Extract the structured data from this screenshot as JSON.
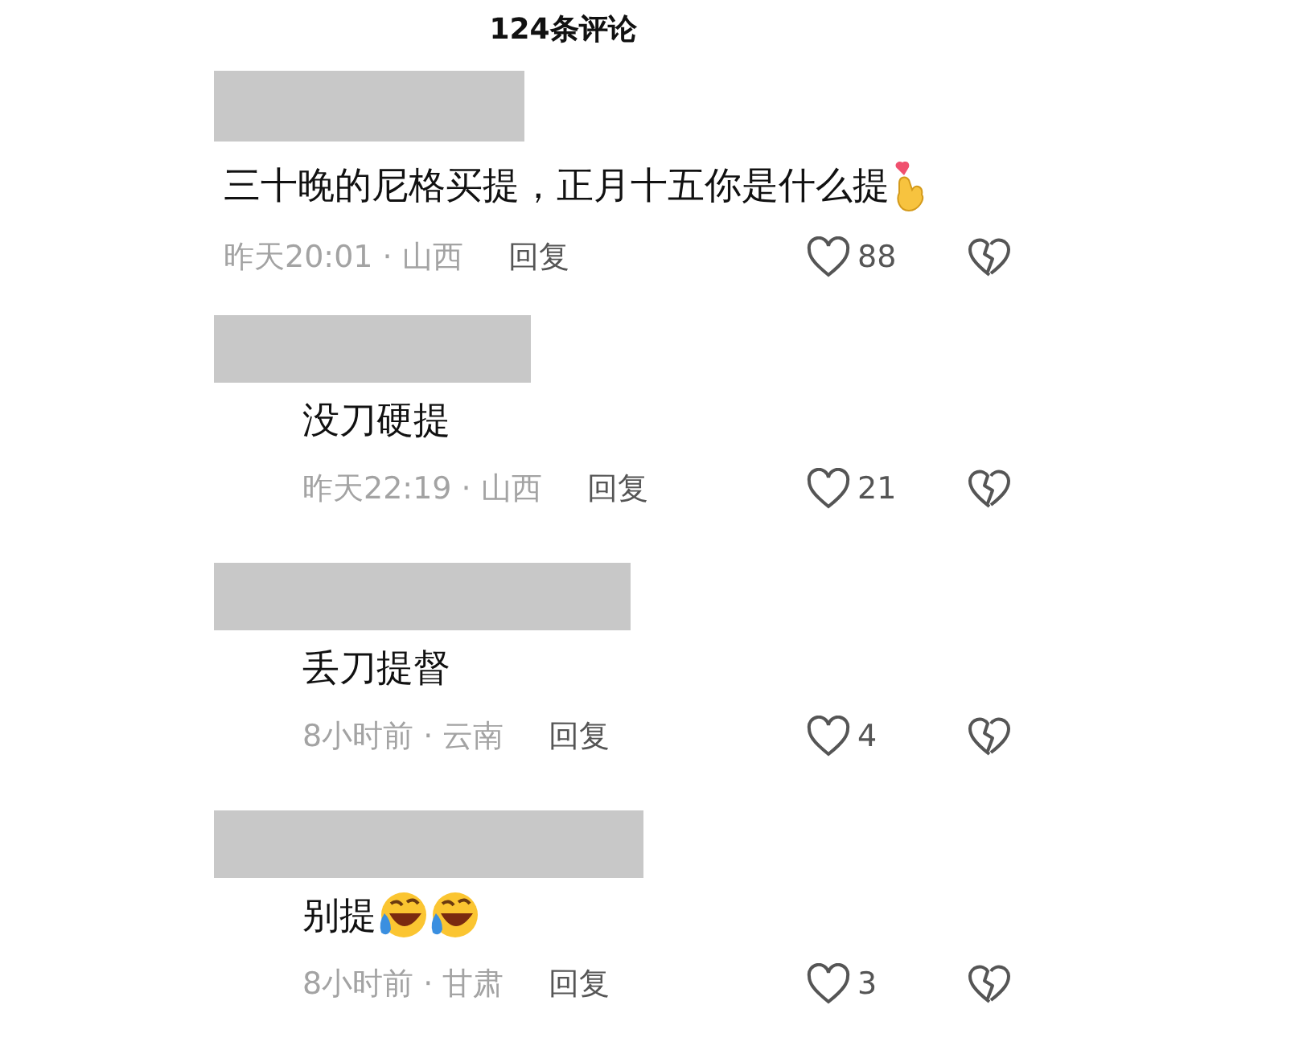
{
  "header": {
    "title": "124条评论"
  },
  "comment": {
    "text": "三十晚的尼格买提，正月十五你是什么提",
    "emojis": [
      {
        "kind": "finger-heart"
      }
    ],
    "time_region": "昨天20:01 · 山西",
    "reply": "回复",
    "likes": "88",
    "children": [
      {
        "text": "没刀硬提",
        "time_region": "昨天22:19 · 山西",
        "reply": "回复",
        "likes": "21"
      },
      {
        "text": "丢刀提督",
        "time_region": "8小时前 · 云南",
        "reply": "回复",
        "likes": "4"
      },
      {
        "text": "别提",
        "emojis": [
          {
            "kind": "laughing-tears"
          },
          {
            "kind": "laughing-tears"
          }
        ],
        "time_region": "8小时前 · 甘肃",
        "reply": "回复",
        "likes": "3"
      }
    ]
  }
}
